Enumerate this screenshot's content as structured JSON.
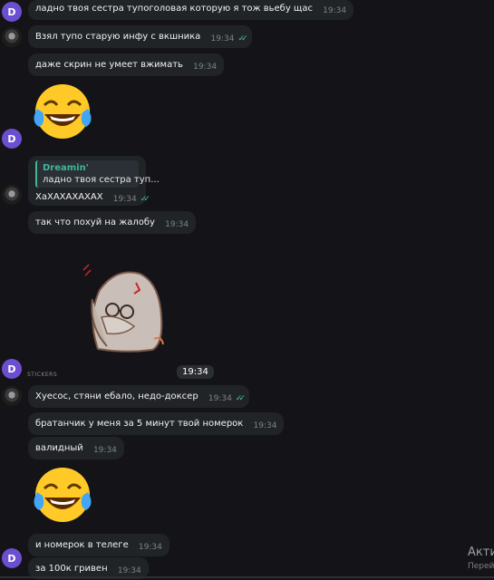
{
  "messages": [
    {
      "text": "ладно твоя сестра тупоголовая которую я тож вьебу щас",
      "time": "19:34"
    },
    {
      "text": "Взял тупо старую инфу с вкшника",
      "time": "19:34"
    },
    {
      "text": "даже скрин не умеет вжимать",
      "time": "19:34"
    },
    {
      "reply_author": "Dreamin'",
      "reply_text": "ладно твоя сестра туп...",
      "text": "ХаХАХАХАХАХ",
      "time": "19:34"
    },
    {
      "text": "так что похуй на жалобу",
      "time": "19:34"
    },
    {
      "text": "Хуесос, стяни ебало, недо-доксер",
      "time": "19:34"
    },
    {
      "text": "братанчик у меня за 5 минут твой номерок",
      "time": "19:34"
    },
    {
      "text": "валидный",
      "time": "19:34"
    },
    {
      "text": "и номерок в телеге",
      "time": "19:34"
    },
    {
      "text": "за 100к гривен",
      "time": "19:34"
    }
  ],
  "avatar_letter": "D",
  "sticker_time": "19:34",
  "stickers_label": "STICKERS",
  "overlay": {
    "line1": "Акти",
    "line2": "Перей"
  },
  "colors": {
    "background": "#141418",
    "bubble": "#212427",
    "accent": "#3fb79b",
    "avatar": "#6c4fd0",
    "ticks": "#4fc38d"
  }
}
